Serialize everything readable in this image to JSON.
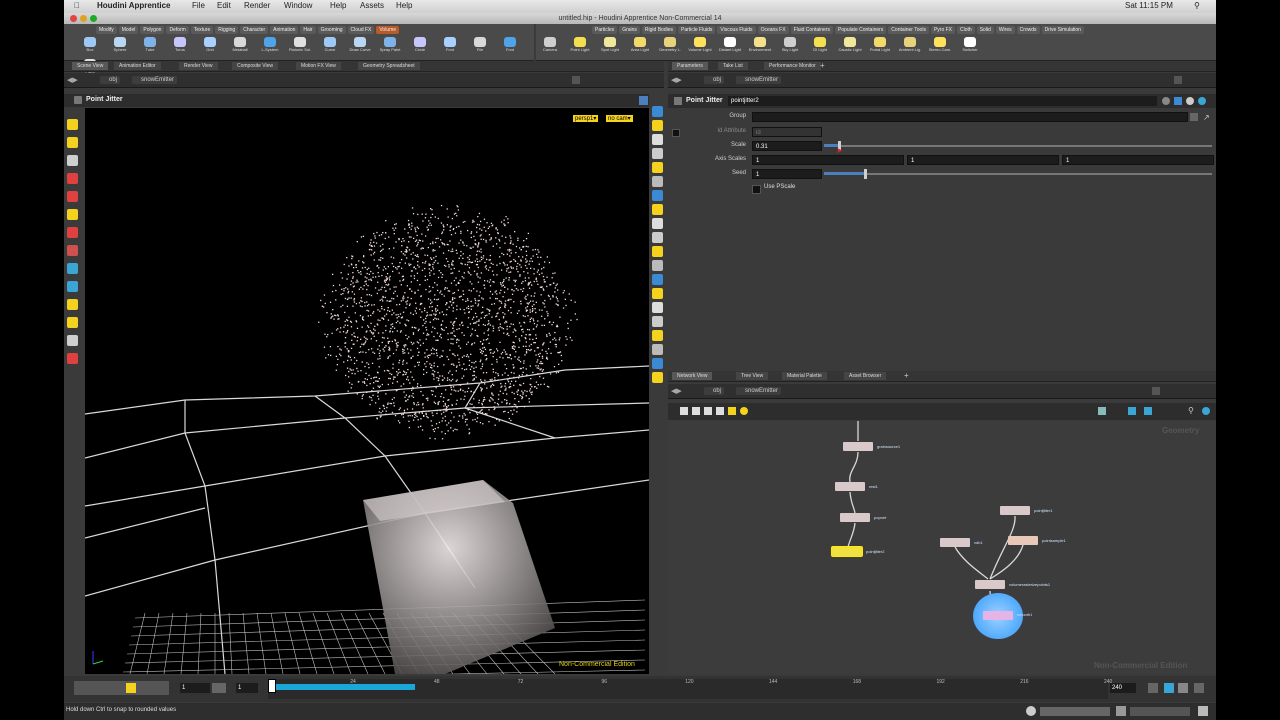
{
  "menubar": {
    "app": "Houdini Apprentice",
    "items": [
      "File",
      "Edit",
      "Render",
      "Window",
      "Help",
      "Assets",
      "Help"
    ],
    "clock": "Sat 11:15 PM"
  },
  "window_title": "untitled.hip - Houdini Apprentice Non-Commercial 14",
  "shelf_left": {
    "tabs": [
      "Modify",
      "Model",
      "Polygon",
      "Deform",
      "Texture",
      "Rigging",
      "Character",
      "Animation",
      "Hair",
      "Grooming",
      "Cloud FX",
      "Volume"
    ],
    "active_tab": "Volume",
    "tools": [
      "Box",
      "Sphere",
      "Tube",
      "Torus",
      "Grid",
      "Metaball",
      "L-System",
      "Platonic Sol.",
      "Curve",
      "Draw Curve",
      "Spray Paint",
      "Circle",
      "Font",
      "File",
      "Font",
      "Point"
    ]
  },
  "shelf_right": {
    "tabs": [
      "Particles",
      "Grains",
      "Rigid Bodies",
      "Particle Fluids",
      "Viscous Fluids",
      "Oceans FX",
      "Fluid Containers",
      "Populate Containers",
      "Container Tools",
      "Pyro FX",
      "Cloth",
      "Solid",
      "Wires",
      "Crowds",
      "Drive Simulation"
    ],
    "tools": [
      "Camera",
      "Point Light",
      "Spot Light",
      "Area Light",
      "Geometry L.",
      "Volume Light",
      "Distant Light",
      "Environment",
      "Sky Light",
      "GI Light",
      "Caustic Light",
      "Portal Light",
      "Ambient Lig.",
      "Stereo Cam.",
      "Switcher"
    ]
  },
  "left_panel": {
    "tabs": [
      "Scene View",
      "Animation Editor",
      "Render View",
      "Composite View",
      "Motion FX View",
      "Geometry Spreadsheet"
    ],
    "path": [
      "obj",
      "snowEmitter"
    ],
    "title": "Point Jitter",
    "persp_label": "persp1▾",
    "cam_label": "no cam▾",
    "watermark": "Non-Commercial Edition"
  },
  "params_panel": {
    "tabs": [
      "Parameters",
      "Take List",
      "Performance Monitor"
    ],
    "path": [
      "obj",
      "snowEmitter"
    ],
    "node_type": "Point Jitter",
    "node_name": "pointjitter2",
    "group_label": "Group",
    "group_value": "",
    "id_attr_label": "Id Attribute",
    "id_attr_value": "id",
    "scale_label": "Scale",
    "scale_value": "0.31",
    "scale_fraction": 0.31,
    "axis_label": "Axis Scales",
    "axis_values": [
      "1",
      "1",
      "1"
    ],
    "seed_label": "Seed",
    "seed_value": "1",
    "seed_fraction": 0.2,
    "pscale_label": "Use PScale"
  },
  "network_panel": {
    "tabs": [
      "Network View",
      "Tree View",
      "Material Palette",
      "Asset Browser"
    ],
    "path": [
      "obj",
      "snowEmitter"
    ],
    "context_label": "Geometry",
    "watermark": "Non-Commercial Edition",
    "nodes": {
      "grainsource1": "grainsource1",
      "rest1": "rest1",
      "popnet": "popnet",
      "pointjitter2": "pointjitter2",
      "pointjitter1": "pointjitter1",
      "vdb1": "vdb1",
      "pointsample1": "pointsample1",
      "volumerasterize": "volumerasterizepoints1",
      "smooth1": "smooth1"
    }
  },
  "timeline": {
    "start_field": "1",
    "current_field": "1",
    "ticks": [
      "1",
      "24",
      "48",
      "72",
      "96",
      "120",
      "144",
      "168",
      "192",
      "216",
      "240"
    ],
    "end_field": "240",
    "playhead_fraction": 0.0,
    "cached_fraction": 0.7
  },
  "status": {
    "message": "Hold down Ctrl to snap to rounded values"
  },
  "colors": {
    "accent_yellow": "#f5d21e",
    "selected_node": "#f0e040",
    "wire": "#d8d8d8",
    "slider_blue": "#4d7fbd",
    "cache_bar": "#1aa6d6"
  }
}
